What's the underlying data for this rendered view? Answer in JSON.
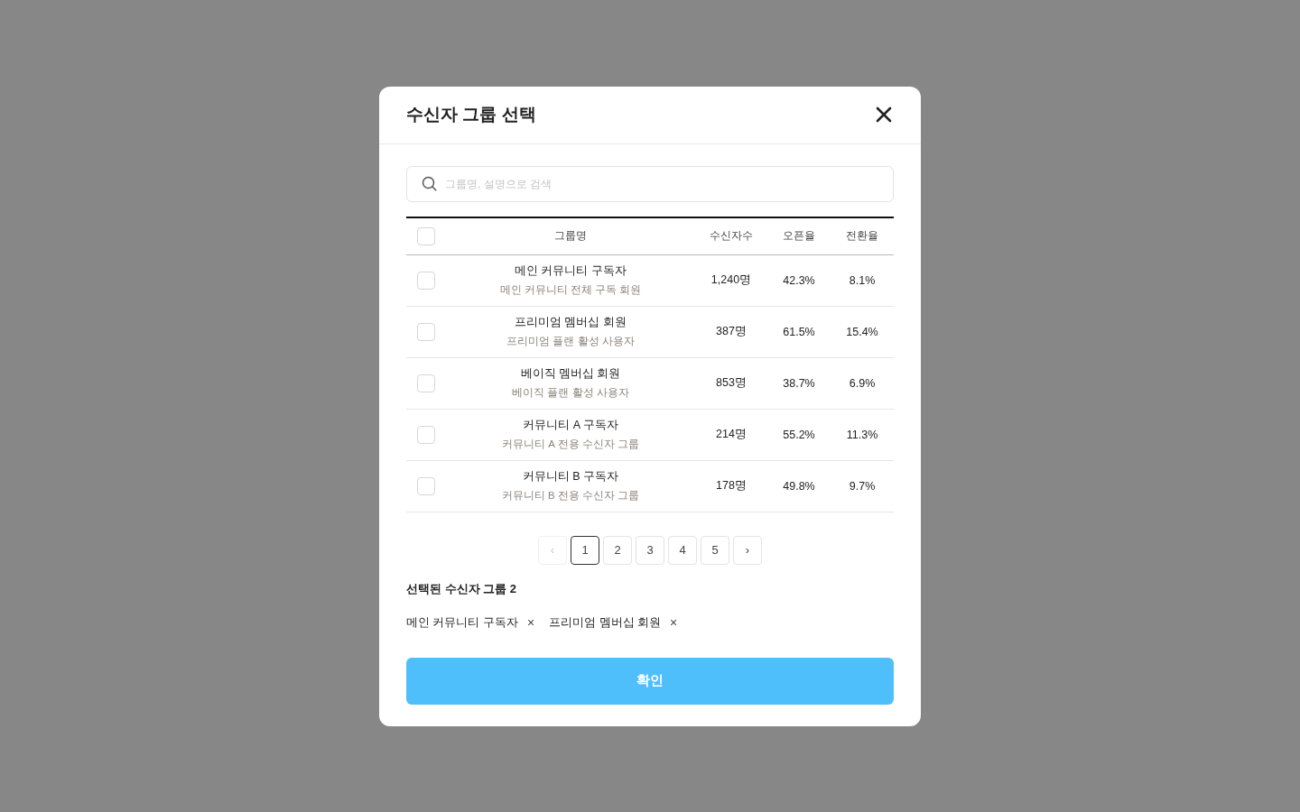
{
  "modal": {
    "title": "수신자 그룹 선택"
  },
  "search": {
    "placeholder": "그룹명, 설명으로 검색"
  },
  "table": {
    "select_all": {
      "checked": false
    },
    "columns": [
      "그룹명",
      "수신자수",
      "오픈율",
      "전환율"
    ],
    "rows": [
      {
        "name": "메인 커뮤니티 구독자",
        "description": "메인 커뮤니티 전체 구독 회원",
        "recipients": "1,240명",
        "open_rate": "42.3%",
        "conversion_rate": "8.1%",
        "checked": false
      },
      {
        "name": "프리미엄 멤버십 회원",
        "description": "프리미엄 플랜 활성 사용자",
        "recipients": "387명",
        "open_rate": "61.5%",
        "conversion_rate": "15.4%",
        "checked": false
      },
      {
        "name": "베이직 멤버십 회원",
        "description": "베이직 플랜 활성 사용자",
        "recipients": "853명",
        "open_rate": "38.7%",
        "conversion_rate": "6.9%",
        "checked": false
      },
      {
        "name": "커뮤니티 A 구독자",
        "description": "커뮤니티 A 전용 수신자 그룹",
        "recipients": "214명",
        "open_rate": "55.2%",
        "conversion_rate": "11.3%",
        "checked": false
      },
      {
        "name": "커뮤니티 B 구독자",
        "description": "커뮤니티 B 전용 수신자 그룹",
        "recipients": "178명",
        "open_rate": "49.8%",
        "conversion_rate": "9.7%",
        "checked": false
      }
    ]
  },
  "pagination": {
    "prev": {
      "label": "‹",
      "disabled": true
    },
    "pages": [
      {
        "label": "1",
        "selected": true
      },
      {
        "label": "2",
        "selected": false
      },
      {
        "label": "3",
        "selected": false
      },
      {
        "label": "4",
        "selected": false
      },
      {
        "label": "5",
        "selected": false
      }
    ],
    "next": {
      "label": "›",
      "disabled": false
    }
  },
  "selected_groups": {
    "title": "선택된 수신자 그룹 2",
    "chips": [
      {
        "label": "메인 커뮤니티 구독자",
        "remove": "×"
      },
      {
        "label": "프리미엄 멤버십 회원",
        "remove": "×"
      }
    ]
  },
  "confirm_button": {
    "label": "확인"
  }
}
